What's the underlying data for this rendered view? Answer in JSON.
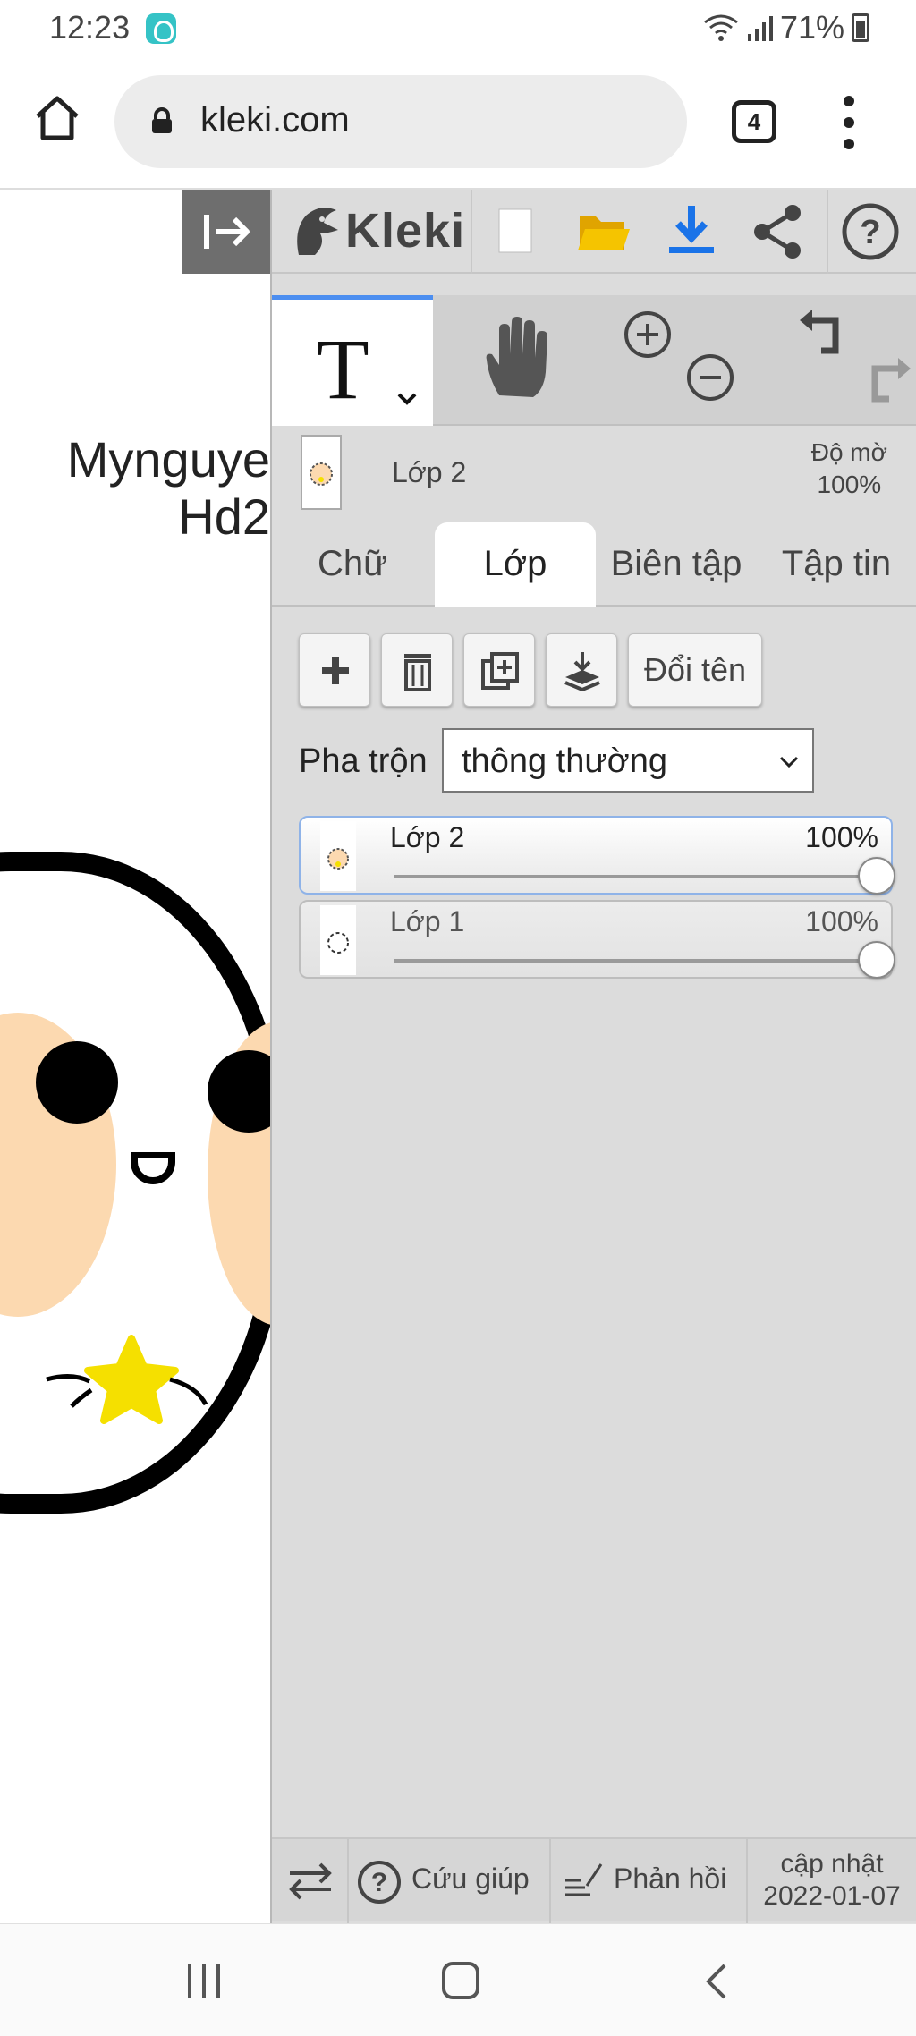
{
  "status_bar": {
    "time": "12:23",
    "battery": "71%",
    "icons": [
      "app-icon",
      "wifi-icon",
      "signal-icon",
      "battery-icon"
    ]
  },
  "browser": {
    "url": "kleki.com",
    "tab_count": "4",
    "icons": [
      "home-icon",
      "lock-icon",
      "tabs-icon",
      "more-vert-icon"
    ]
  },
  "canvas": {
    "caption_line1": "Mynguye",
    "caption_line2": "Hd2",
    "colors": {
      "outline": "#000000",
      "cheek": "#fcd9b0",
      "star": "#f5e000"
    }
  },
  "app": {
    "logo": "Kleki",
    "topbar_icons": [
      "collapse-panel-icon",
      "new-image-icon",
      "open-folder-icon",
      "download-icon",
      "share-icon",
      "help-icon"
    ]
  },
  "tools": {
    "text_tool_glyph": "T",
    "active_tool": "text",
    "icons": [
      "text-tool-icon",
      "hand-tool-icon",
      "zoom-in-icon",
      "zoom-out-icon",
      "undo-icon",
      "redo-icon"
    ]
  },
  "active_layer": {
    "name": "Lớp 2",
    "opacity_label": "Độ mờ",
    "opacity_value": "100%"
  },
  "tabs": [
    {
      "label": "Chữ",
      "active": false
    },
    {
      "label": "Lớp",
      "active": true
    },
    {
      "label": "Biên tập",
      "active": false
    },
    {
      "label": "Tập tin",
      "active": false
    }
  ],
  "layer_actions": {
    "icons": [
      "add-layer-icon",
      "delete-layer-icon",
      "duplicate-layer-icon",
      "merge-down-icon"
    ],
    "rename_label": "Đổi tên"
  },
  "blend": {
    "label": "Pha trộn",
    "value": "thông thường"
  },
  "layers": [
    {
      "name": "Lớp 2",
      "opacity": "100%",
      "opacity_fraction": 1.0,
      "selected": true
    },
    {
      "name": "Lớp 1",
      "opacity": "100%",
      "opacity_fraction": 1.0,
      "selected": false
    }
  ],
  "footer": {
    "help_label": "Cứu giúp",
    "feedback_label": "Phản hồi",
    "update_label": "cập nhật",
    "update_date": "2022-01-07",
    "icons": [
      "swap-side-icon",
      "help-circle-icon",
      "feedback-icon"
    ]
  },
  "navigation": {
    "icons": [
      "recents-icon",
      "home-nav-icon",
      "back-icon"
    ]
  },
  "colors": {
    "accent": "#4c8ef0",
    "download_blue": "#1a73e8",
    "folder_yellow": "#f5b800",
    "panel_bg": "#dcdcdc"
  }
}
